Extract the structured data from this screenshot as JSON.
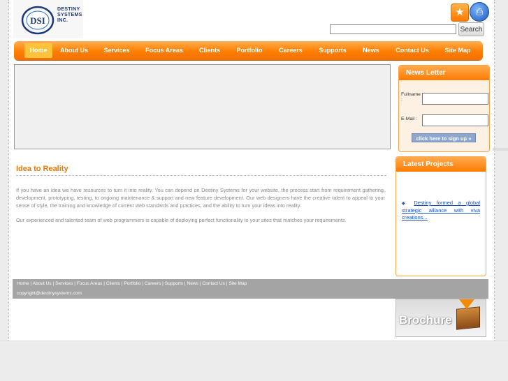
{
  "logo": {
    "letters": "DSI",
    "line1": "DESTINY",
    "line2": "SYSTEMS",
    "line3": "INC."
  },
  "header": {
    "search_placeholder": "",
    "search_label": "Search",
    "icons": [
      "bookmark-star-icon",
      "print-icon"
    ]
  },
  "nav": {
    "items": [
      {
        "label": "Home",
        "active": true
      },
      {
        "label": "About Us"
      },
      {
        "label": "Services"
      },
      {
        "label": "Focus Areas"
      },
      {
        "label": "Clients"
      },
      {
        "label": "Portfolio"
      },
      {
        "label": "Careers"
      },
      {
        "label": "Supports"
      },
      {
        "label": "News"
      },
      {
        "label": "Contact Us"
      },
      {
        "label": "Site Map"
      }
    ]
  },
  "main": {
    "heading": "Idea to Reality",
    "para1": "If you have an idea we have resources to turn it into reality. You can depend on Destiny Systems for your website, the process start from requirement gathering, development, prototyping, testing, to ongoing maintenance & support and new feature development. Our web designers have the creative talent to appeal to your sense of style, the training and knowledge of current web standards and practices, and the ability to turn your ideas into reality.",
    "para2": "Our experienced and talented team of web programmers is capable of deploying perfect functionality to your sites that matches your requirements."
  },
  "newsletter": {
    "title": "News Letter",
    "fullname_label": "Fullname :",
    "email_label": "E-Mail :",
    "signup_label": "click here to sign up"
  },
  "projects": {
    "title": "Latest Projects",
    "item": "Destiny formed a global strategic alliance with viva creations..."
  },
  "footer": {
    "links": "Home | About Us | Services | Focus Areas | Clients | Portfolio | Careers | Supports | News | Contact Us | Site Map",
    "copyright": "copyright@destinysystems.com"
  },
  "brochure": {
    "label": "Brochure"
  },
  "colors": {
    "accent": "#ff7e00",
    "heading": "#f07800",
    "link": "#1b4fbf",
    "footer": "#a4a4a4"
  }
}
